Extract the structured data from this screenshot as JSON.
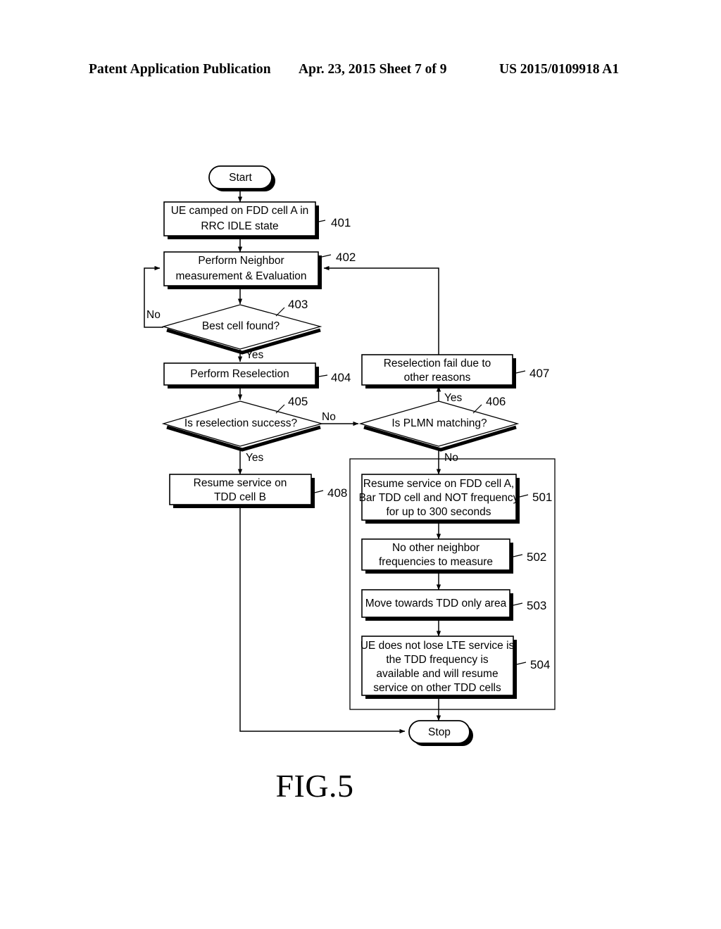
{
  "header": {
    "publication": "Patent Application Publication",
    "date_sheet": "Apr. 23, 2015  Sheet 7 of 9",
    "patent_number": "US 2015/0109918 A1"
  },
  "figure": {
    "caption": "FIG.5"
  },
  "flowchart": {
    "terminals": {
      "start": "Start",
      "stop": "Stop"
    },
    "nodes": [
      {
        "ref": "401",
        "lines": [
          "UE camped on FDD cell A in",
          "RRC IDLE state"
        ],
        "shape": "process"
      },
      {
        "ref": "402",
        "lines": [
          "Perform Neighbor",
          "measurement & Evaluation"
        ],
        "shape": "process"
      },
      {
        "ref": "403",
        "lines": [
          "Best cell found?"
        ],
        "shape": "decision"
      },
      {
        "ref": "404",
        "lines": [
          "Perform Reselection"
        ],
        "shape": "process"
      },
      {
        "ref": "405",
        "lines": [
          "Is reselection success?"
        ],
        "shape": "decision"
      },
      {
        "ref": "406",
        "lines": [
          "Is PLMN matching?"
        ],
        "shape": "decision"
      },
      {
        "ref": "407",
        "lines": [
          "Reselection fail due to",
          "other reasons"
        ],
        "shape": "process"
      },
      {
        "ref": "408",
        "lines": [
          "Resume service on",
          "TDD cell B"
        ],
        "shape": "process"
      },
      {
        "ref": "501",
        "lines": [
          "Resume service on FDD cell A,",
          "Bar TDD cell and NOT frequency",
          "for up to 300 seconds"
        ],
        "shape": "process"
      },
      {
        "ref": "502",
        "lines": [
          "No other neighbor",
          "frequencies to measure"
        ],
        "shape": "process"
      },
      {
        "ref": "503",
        "lines": [
          "Move towards TDD only area"
        ],
        "shape": "process"
      },
      {
        "ref": "504",
        "lines": [
          "UE does not lose LTE service is",
          "the TDD frequency is",
          "available and will resume",
          "service on other TDD cells"
        ],
        "shape": "process"
      }
    ],
    "edge_labels": {
      "best_cell_no": "No",
      "best_cell_yes": "Yes",
      "reselection_yes": "Yes",
      "reselection_no": "No",
      "plmn_yes": "Yes",
      "plmn_no": "No"
    }
  },
  "colors": {
    "ink": "#000000",
    "paper": "#ffffff"
  }
}
